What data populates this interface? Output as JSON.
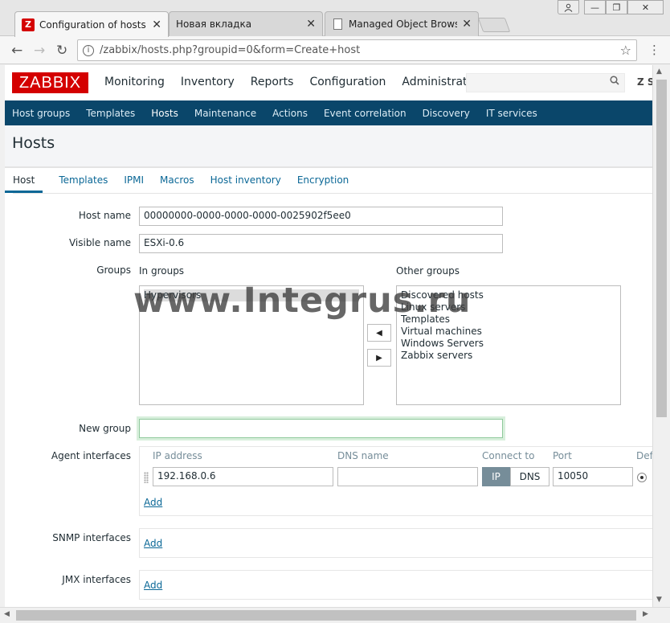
{
  "browser": {
    "tabs": [
      {
        "title": "Configuration of hosts",
        "favicon": "Z",
        "active": true
      },
      {
        "title": "Новая вкладка",
        "active": false
      },
      {
        "title": "Managed Object Browser",
        "active": false
      }
    ],
    "url_domain": "zabbix",
    "url_path": "/zabbix/hosts.php?groupid=0&form=Create+host"
  },
  "app": {
    "logo": "ZABBIX",
    "main_menu": [
      "Monitoring",
      "Inventory",
      "Reports",
      "Configuration",
      "Administration"
    ],
    "support_label": "Z S",
    "sub_menu": [
      "Host groups",
      "Templates",
      "Hosts",
      "Maintenance",
      "Actions",
      "Event correlation",
      "Discovery",
      "IT services"
    ],
    "page_title": "Hosts"
  },
  "form": {
    "tabs": [
      "Host",
      "Templates",
      "IPMI",
      "Macros",
      "Host inventory",
      "Encryption"
    ],
    "host_name_label": "Host name",
    "host_name_value": "00000000-0000-0000-0000-0025902f5ee0",
    "visible_name_label": "Visible name",
    "visible_name_value": "ESXi-0.6",
    "groups_label": "Groups",
    "in_groups_label": "In groups",
    "other_groups_label": "Other groups",
    "in_groups": [
      "Hypervisors"
    ],
    "other_groups": [
      "Discovered hosts",
      "Linux servers",
      "Templates",
      "Virtual machines",
      "Windows Servers",
      "Zabbix servers"
    ],
    "new_group_label": "New group",
    "new_group_value": "",
    "agent_interfaces_label": "Agent interfaces",
    "columns": {
      "ip": "IP address",
      "dns": "DNS name",
      "connect": "Connect to",
      "port": "Port",
      "default": "Def"
    },
    "agent": {
      "ip": "192.168.0.6",
      "dns": "",
      "connect_ip": "IP",
      "connect_dns": "DNS",
      "port": "10050"
    },
    "add_label": "Add",
    "snmp_label": "SNMP interfaces",
    "jmx_label": "JMX interfaces"
  },
  "watermark": "www.Integrus.ru",
  "colors": {
    "brand": "#d40000",
    "subnav": "#0a466a",
    "link": "#0a6796"
  }
}
